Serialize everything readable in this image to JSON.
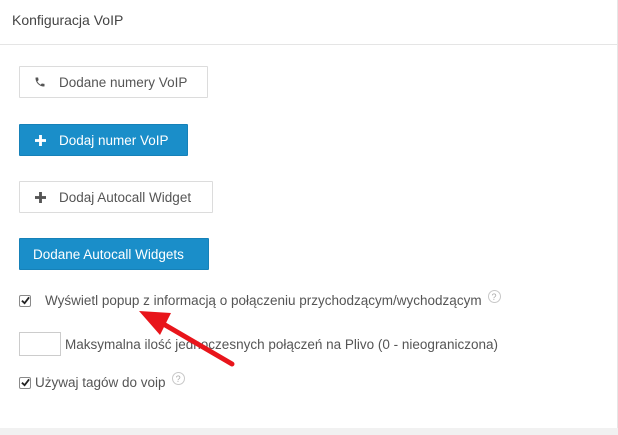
{
  "header": {
    "title": "Konfiguracja VoIP"
  },
  "buttons": {
    "added_numbers": {
      "label": "Dodane numery VoIP",
      "icon": "phone-icon"
    },
    "add_number": {
      "label": "Dodaj numer VoIP",
      "icon": "plus-icon"
    },
    "add_widget": {
      "label": "Dodaj Autocall Widget",
      "icon": "plus-icon"
    },
    "added_widgets": {
      "label": "Dodane Autocall Widgets"
    }
  },
  "options": {
    "popup": {
      "label": "Wyświetl popup z informacją o połączeniu przychodzącym/wychodzącym",
      "checked": true,
      "help": "?"
    },
    "max_calls": {
      "label": "Maksymalna ilość jednoczesnych połączeń na Plivo (0 - nieograniczona)",
      "value": ""
    },
    "tags": {
      "label": "Używaj tagów do voip",
      "checked": true,
      "help": "?"
    }
  },
  "colors": {
    "primary": "#1a8ec9",
    "annotation_arrow": "#e8151b"
  }
}
